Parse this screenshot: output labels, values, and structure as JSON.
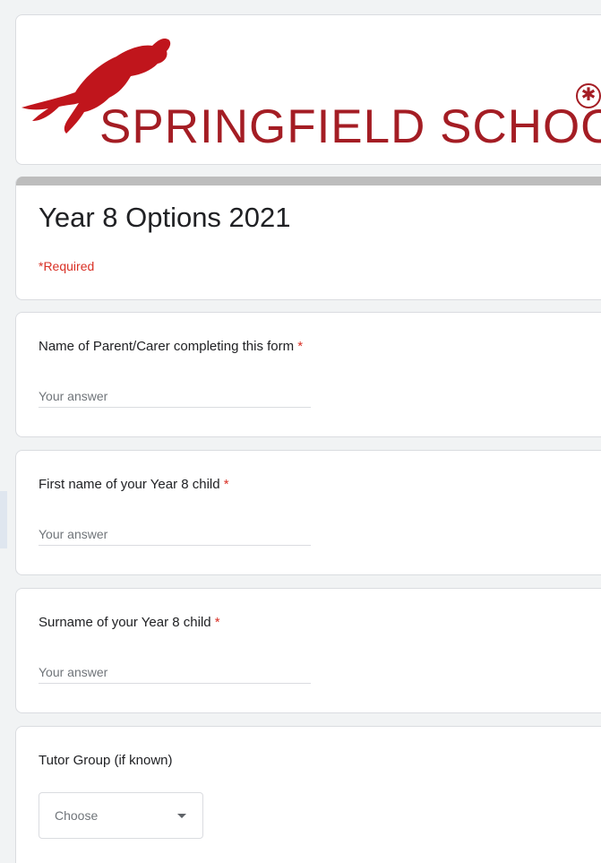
{
  "banner": {
    "school_name": "SPRINGFIELD SCHOOL",
    "brand_color": "#a41d24",
    "logo_icon": "leaping-panther-icon",
    "seal_icon": "asterisk-seal-icon"
  },
  "form": {
    "title": "Year 8 Options 2021",
    "required_note": "*Required",
    "required_color": "#d93025"
  },
  "questions": [
    {
      "label": "Name of Parent/Carer completing this form",
      "required_mark": "*",
      "placeholder": "Your answer"
    },
    {
      "label": "First name of your Year 8 child",
      "required_mark": "*",
      "placeholder": "Your answer"
    },
    {
      "label": "Surname of your Year 8 child",
      "required_mark": "*",
      "placeholder": "Your answer"
    }
  ],
  "tutor_group": {
    "label": "Tutor Group (if known)",
    "selected": "Choose"
  }
}
